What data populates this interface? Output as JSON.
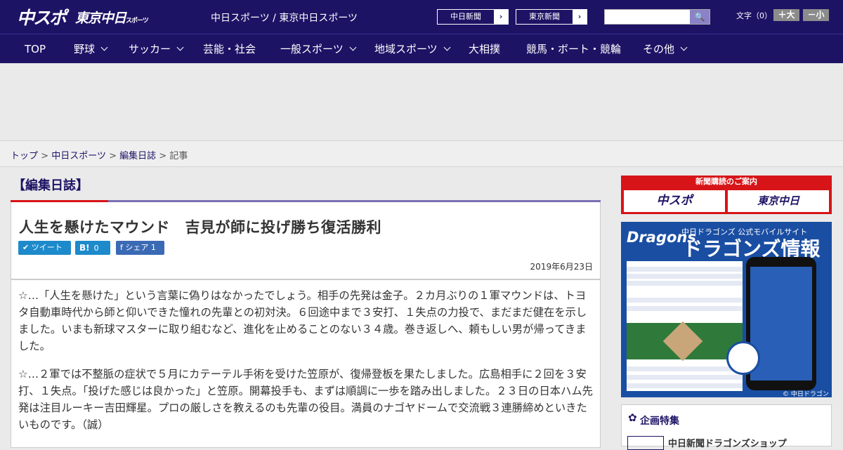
{
  "header": {
    "logo_main": "中スポ",
    "logo_sub": "東京中日",
    "logo_sub_small": "スポーツ",
    "site_title": "中日スポーツ / 東京中日スポーツ",
    "news_buttons": [
      {
        "label": "中日新聞",
        "arrow": "›"
      },
      {
        "label": "東京新聞",
        "arrow": "›"
      }
    ],
    "search_placeholder": "",
    "search_icon": "🔍",
    "font_label": "文字（0）",
    "font_bigger": "＋大",
    "font_smaller": "－小"
  },
  "nav": {
    "items": [
      {
        "label": "TOP",
        "dropdown": false
      },
      {
        "label": "野球",
        "dropdown": true
      },
      {
        "label": "サッカー",
        "dropdown": true
      },
      {
        "label": "芸能・社会",
        "dropdown": false
      },
      {
        "label": "一般スポーツ",
        "dropdown": true
      },
      {
        "label": "地域スポーツ",
        "dropdown": true
      },
      {
        "label": "大相撲",
        "dropdown": false
      },
      {
        "label": "競馬・ボート・競輪",
        "dropdown": false
      },
      {
        "label": "その他",
        "dropdown": true
      }
    ]
  },
  "breadcrumb": {
    "items": [
      "トップ",
      "中日スポーツ",
      "編集日誌"
    ],
    "sep": ">",
    "current": "記事"
  },
  "article": {
    "section": "【編集日誌】",
    "title": "人生を懸けたマウンド　吉見が師に投げ勝ち復活勝利",
    "share": {
      "tweet": "ツイート",
      "hatena": "B!",
      "hatena_count": "0",
      "facebook": "シェア",
      "facebook_count": "1"
    },
    "date": "2019年6月23日",
    "paragraphs": [
      "☆…「人生を懸けた」という言葉に偽りはなかったでしょう。相手の先発は金子。２カ月ぶりの１軍マウンドは、トヨタ自動車時代から師と仰いできた憧れの先輩との初対決。６回途中まで３安打、１失点の力投で、まだまだ健在を示しました。いまも新球マスターに取り組むなど、進化を止めることのない３４歳。巻き返しへ、頼もしい男が帰ってきました。",
      "☆…２軍では不整脈の症状で５月にカテーテル手術を受けた笠原が、復帰登板を果たしました。広島相手に２回を３安打、１失点。「投げた感じは良かった」と笠原。開幕投手も、まずは順調に一歩を踏み出しました。２３日の日本ハム先発は注目ルーキー吉田輝星。プロの厳しさを教えるのも先輩の役目。満員のナゴヤドームで交流戦３連勝締めといきたいものです。（誠）"
    ]
  },
  "sidebar": {
    "subscribe_head": "新聞購読のご案内",
    "subscribe_a": "中スポ",
    "subscribe_b": "東京中日",
    "dragons": {
      "logo": "Dragons",
      "subtitle": "中日ドラゴンズ 公式モバイルサイト",
      "title": "ドラゴンズ情報",
      "copyright": "© 中日ドラゴンズ"
    },
    "feature": {
      "title": "企画特集",
      "item": "中日新聞ドラゴンズショップ"
    }
  },
  "colors": {
    "brand": "#1d1365",
    "accent_red": "#d71418",
    "twitter": "#1d8acb",
    "facebook": "#3b6ab5"
  }
}
